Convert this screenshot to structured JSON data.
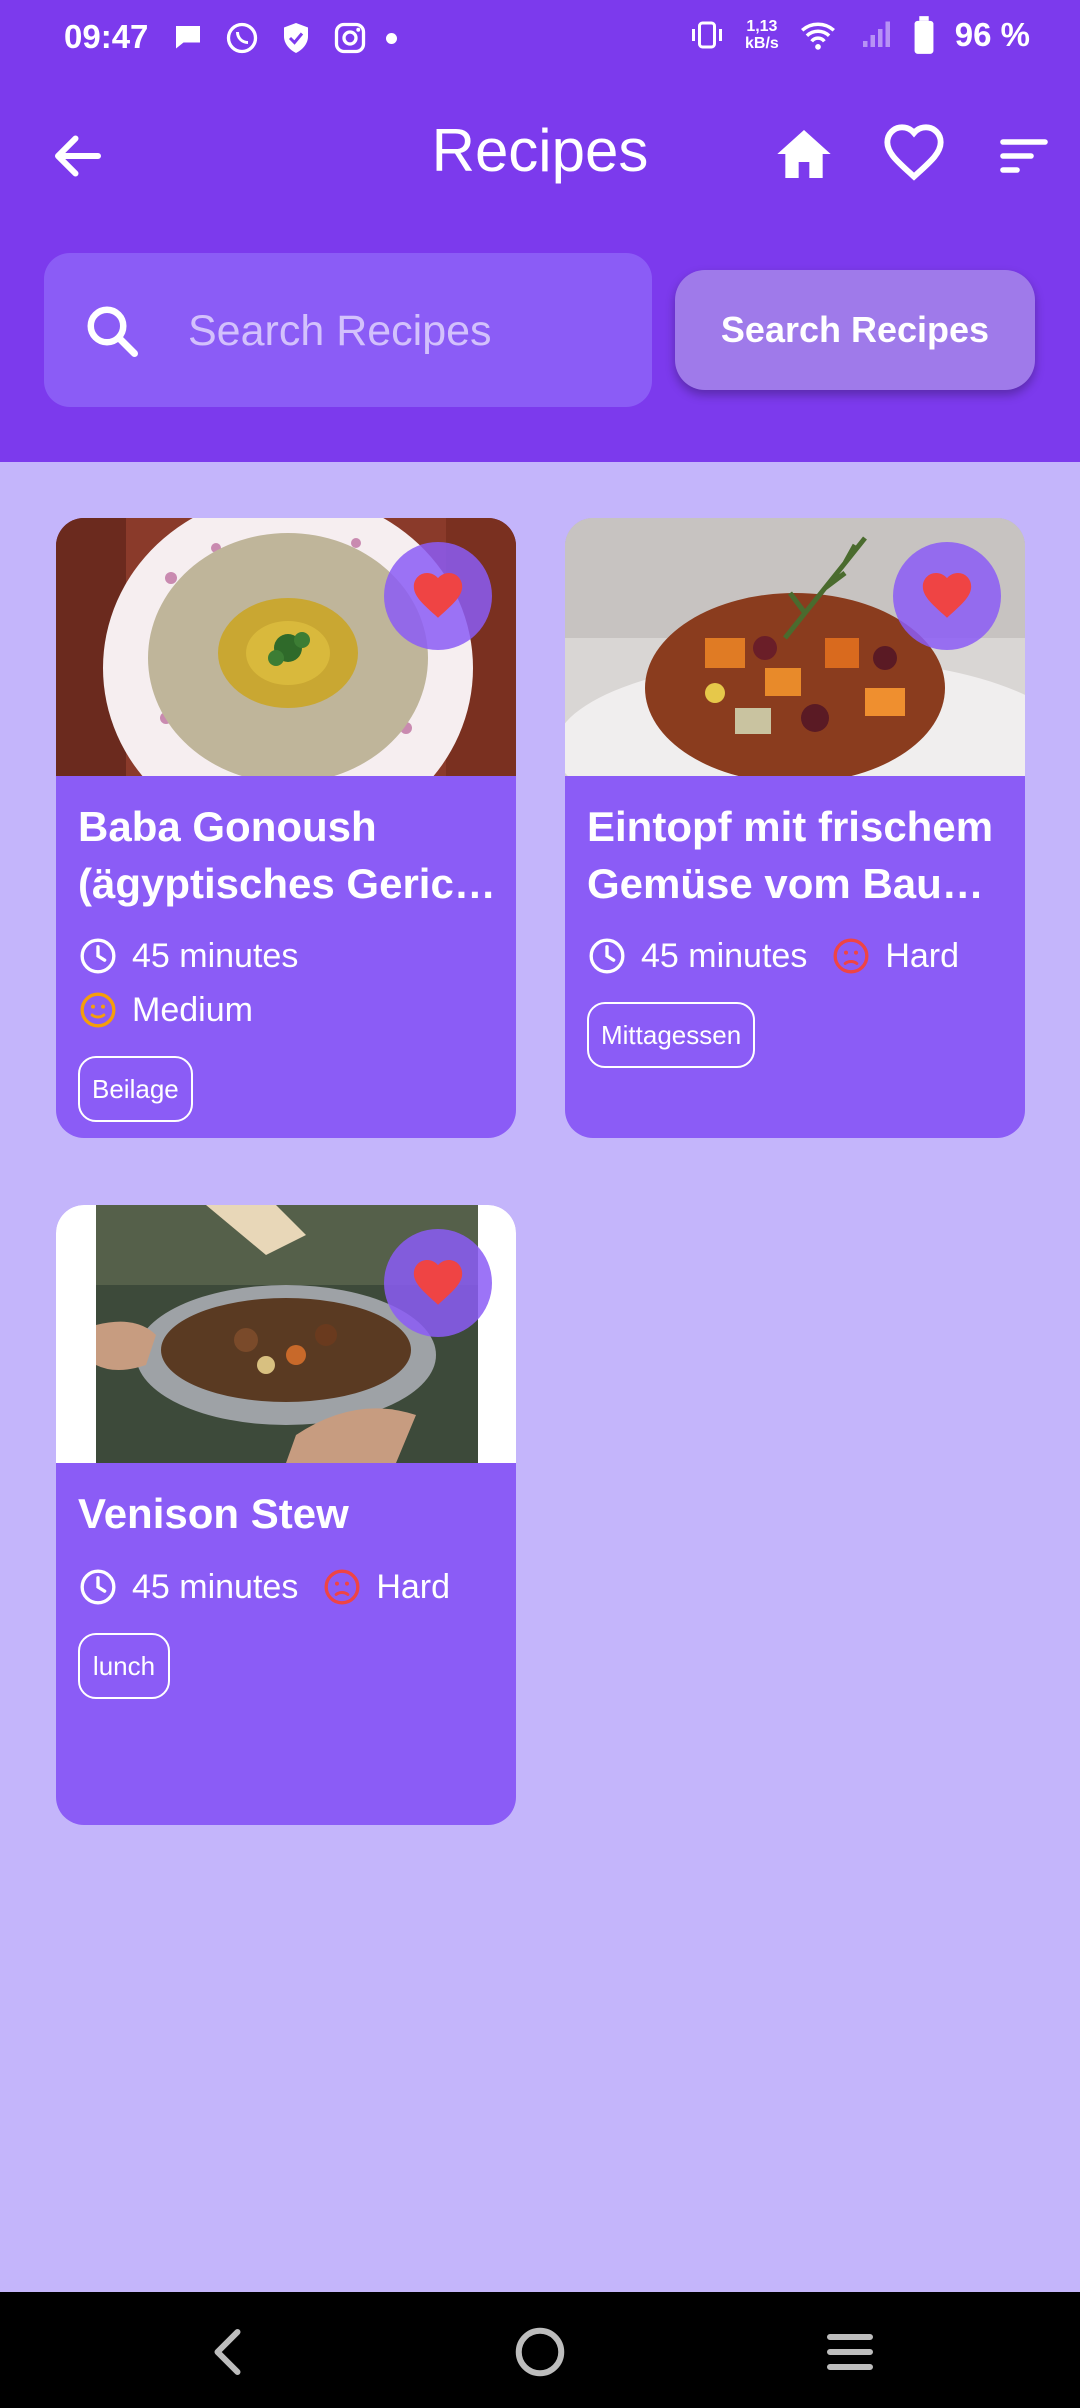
{
  "status_bar": {
    "time": "09:47",
    "net_speed_value": "1,13",
    "net_speed_unit": "kB/s",
    "battery": "96 %"
  },
  "header": {
    "title": "Recipes"
  },
  "search": {
    "placeholder": "Search Recipes",
    "button_label": "Search Recipes"
  },
  "recipes": [
    {
      "title_line1": "Baba Gonoush",
      "title_line2": "(ägyptisches Geric…",
      "time": "45 minutes",
      "difficulty": "Medium",
      "tag": "Beilage"
    },
    {
      "title_line1": "Eintopf mit frischem",
      "title_line2": "Gemüse vom Baue…",
      "time": "45 minutes",
      "difficulty": "Hard",
      "tag": "Mittagessen"
    },
    {
      "title_line1": "Venison Stew",
      "time": "45 minutes",
      "difficulty": "Hard",
      "tag": "lunch"
    }
  ],
  "colors": {
    "primary": "#7C3AED",
    "card": "#8B5CF6",
    "background": "#C4B5FB",
    "favorite_red": "#EF4444",
    "medium_orange": "#F59E0B",
    "hard_red": "#EF4444"
  },
  "icons": {
    "back": "arrow-left-icon",
    "home": "home-icon",
    "favorites": "heart-outline-icon",
    "sort": "sort-icon",
    "search": "search-icon",
    "favorite": "heart-filled-icon",
    "time": "clock-icon",
    "difficulty": "face-icon"
  }
}
